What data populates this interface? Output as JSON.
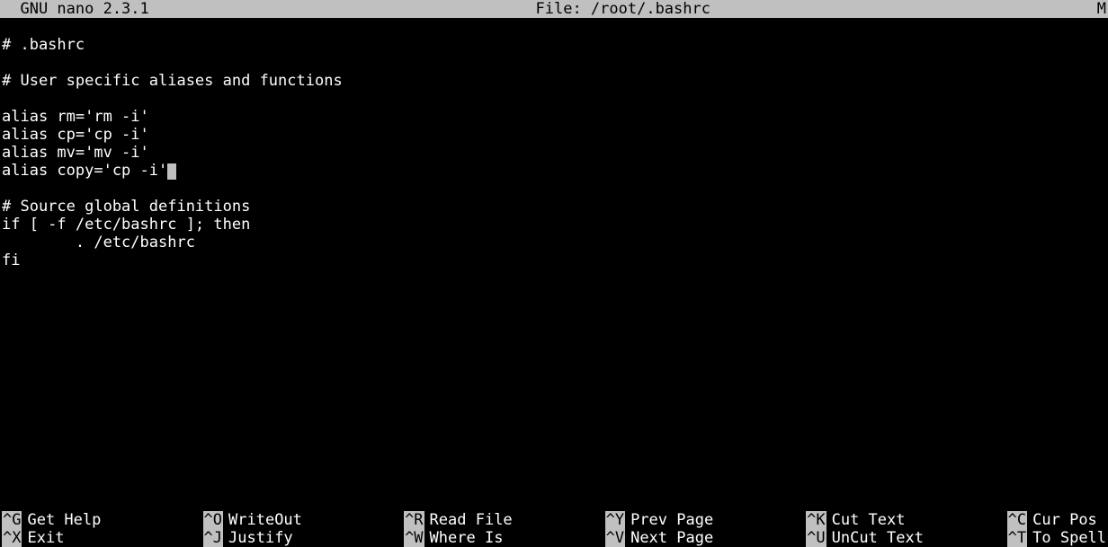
{
  "titlebar": {
    "app": "  GNU nano 2.3.1",
    "file_label": "File: /root/.bashrc",
    "modified_flag": "M"
  },
  "buffer": {
    "lines": [
      "# .bashrc",
      "",
      "# User specific aliases and functions",
      "",
      "alias rm='rm -i'",
      "alias cp='cp -i'",
      "alias mv='mv -i'",
      "alias copy='cp -i'",
      "",
      "# Source global definitions",
      "if [ -f /etc/bashrc ]; then",
      "        . /etc/bashrc",
      "fi"
    ],
    "cursor_line_index": 7
  },
  "shortcuts": {
    "row1": [
      {
        "key": "^G",
        "label": "Get Help"
      },
      {
        "key": "^O",
        "label": "WriteOut"
      },
      {
        "key": "^R",
        "label": "Read File"
      },
      {
        "key": "^Y",
        "label": "Prev Page"
      },
      {
        "key": "^K",
        "label": "Cut Text"
      },
      {
        "key": "^C",
        "label": "Cur Pos "
      }
    ],
    "row2": [
      {
        "key": "^X",
        "label": "Exit"
      },
      {
        "key": "^J",
        "label": "Justify"
      },
      {
        "key": "^W",
        "label": "Where Is"
      },
      {
        "key": "^V",
        "label": "Next Page"
      },
      {
        "key": "^U",
        "label": "UnCut Text"
      },
      {
        "key": "^T",
        "label": "To Spell"
      }
    ]
  }
}
